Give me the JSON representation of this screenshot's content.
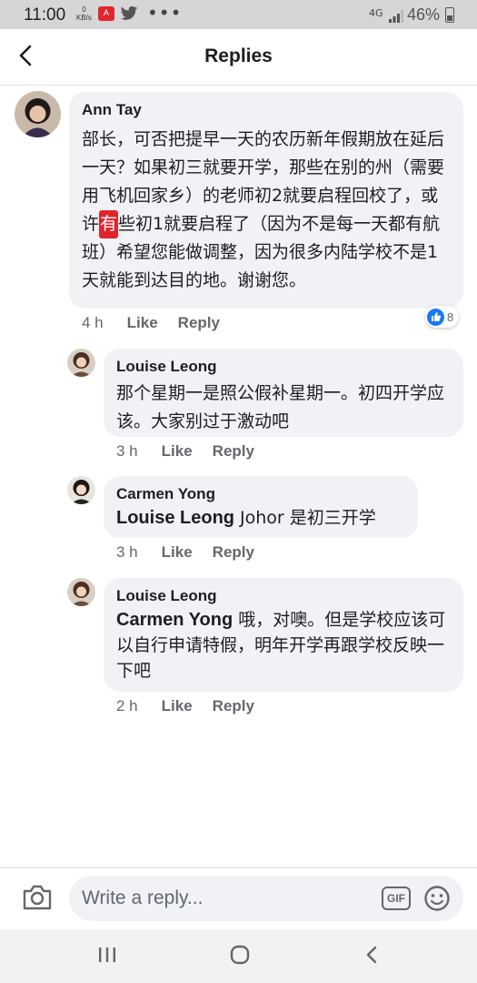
{
  "status_bar": {
    "time": "11:00",
    "kb_value": "0",
    "kb_unit": "KB/s",
    "app_badge": "A",
    "more": "•••",
    "net_type": "4G",
    "battery": "46%"
  },
  "header": {
    "title": "Replies"
  },
  "comments": [
    {
      "author": "Ann Tay",
      "text_before": "部长，可否把提早一天的农历新年假期放在延后一天？如果初三就要开学，那些在别的州（需要用飞机回家乡）的老师初2就要启程回校了，或许",
      "text_emoji": "有",
      "text_after": "些初1就要启程了（因为不是每一天都有航班）希望您能做调整，因为很多内陆学校不是1天就能到达目的地。谢谢您。",
      "time": "4 h",
      "like_label": "Like",
      "reply_label": "Reply",
      "reaction_count": "8"
    },
    {
      "author": "Louise Leong",
      "text": "那个星期一是照公假补星期一。初四开学应该。大家别过于激动吧",
      "time": "3 h",
      "like_label": "Like",
      "reply_label": "Reply"
    },
    {
      "author": "Carmen Yong",
      "mention": "Louise Leong",
      "text": " Johor 是初三开学",
      "time": "3 h",
      "like_label": "Like",
      "reply_label": "Reply"
    },
    {
      "author": "Louise Leong",
      "mention": "Carmen Yong",
      "text": " 哦，对噢。但是学校应该可以自行申请特假，明年开学再跟学校反映一下吧",
      "time": "2 h",
      "like_label": "Like",
      "reply_label": "Reply"
    }
  ],
  "composer": {
    "placeholder": "Write a reply...",
    "gif_label": "GIF"
  },
  "colors": {
    "bubble": "#f0f2f5",
    "accent": "#1877f2",
    "meta": "#65676b"
  }
}
